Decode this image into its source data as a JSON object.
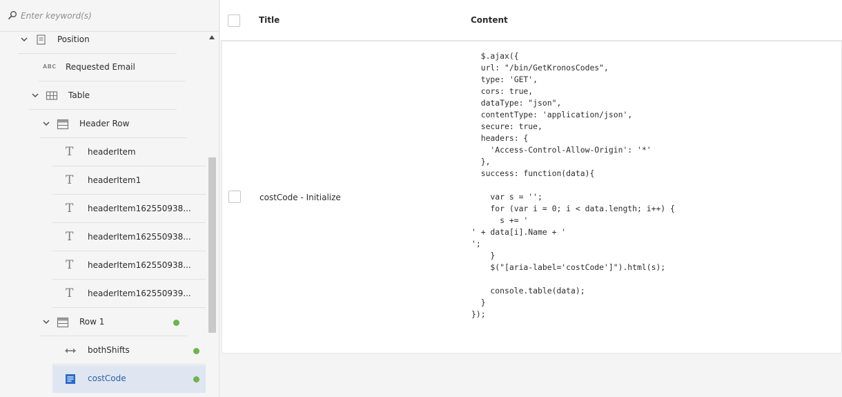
{
  "search": {
    "placeholder": "Enter keyword(s)"
  },
  "tree": {
    "items": [
      {
        "label": "Position",
        "icon": "panel-icon",
        "expanded": true
      },
      {
        "label": "Requested Email",
        "icon": "abc-text-field-icon"
      },
      {
        "label": "Table",
        "icon": "table-icon",
        "expanded": true
      },
      {
        "label": "Header Row",
        "icon": "row-icon",
        "expanded": true
      },
      {
        "label": "headerItem",
        "icon": "text-icon"
      },
      {
        "label": "headerItem1",
        "icon": "text-icon"
      },
      {
        "label": "headerItem162550938...",
        "icon": "text-icon"
      },
      {
        "label": "headerItem162550938...",
        "icon": "text-icon"
      },
      {
        "label": "headerItem162550938...",
        "icon": "text-icon"
      },
      {
        "label": "headerItem162550939...",
        "icon": "text-icon"
      },
      {
        "label": "Row 1",
        "icon": "row-icon",
        "expanded": true,
        "status": "has-script"
      },
      {
        "label": "bothShifts",
        "icon": "switch-icon",
        "status": "has-script"
      },
      {
        "label": "costCode",
        "icon": "dropdown-icon",
        "status": "has-script",
        "selected": true
      }
    ]
  },
  "table": {
    "columns": [
      "Title",
      "Content"
    ],
    "rows": [
      {
        "title": "costCode - Initialize",
        "content": "  $.ajax({\n  url: \"/bin/GetKronosCodes\",\n  type: 'GET',\n  cors: true,\n  dataType: \"json\",\n  contentType: 'application/json',\n  secure: true,\n  headers: {\n    'Access-Control-Allow-Origin': '*'\n  },\n  success: function(data){\n\n    var s = '';\n    for (var i = 0; i < data.length; i++) {\n      s += '\n' + data[i].Name + '\n';\n    }\n    $(\"[aria-label='costCode']\").html(s);\n\n    console.table(data);\n  }\n});"
      }
    ]
  },
  "colors": {
    "status_dot": "#6fb34f",
    "selected_bg": "#dfe6f1",
    "selected_text": "#2c5fa8",
    "selected_icon": "#2c6ac8"
  }
}
